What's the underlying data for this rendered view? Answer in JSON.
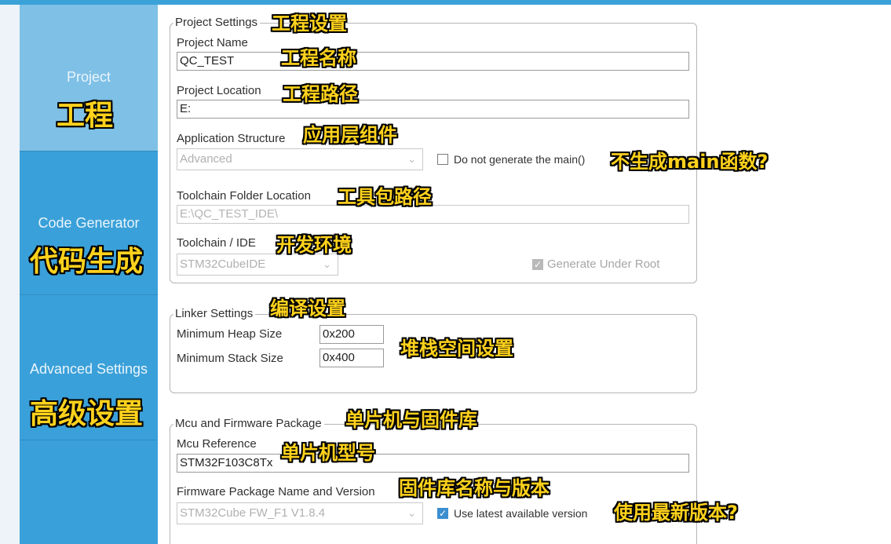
{
  "sidebar": {
    "items": [
      {
        "label": "Project",
        "note": "工程"
      },
      {
        "label": "Code Generator",
        "note": "代码生成"
      },
      {
        "label": "Advanced Settings",
        "note": "高级设置"
      }
    ]
  },
  "project_settings": {
    "legend": "Project Settings",
    "legend_note": "工程设置",
    "project_name": {
      "label": "Project Name",
      "value": "QC_TEST",
      "note": "工程名称"
    },
    "project_location": {
      "label": "Project Location",
      "value": "E:",
      "note": "工程路径"
    },
    "application_structure": {
      "label": "Application Structure",
      "value": "Advanced",
      "note": "应用层组件"
    },
    "no_main": {
      "label": "Do not generate the main()",
      "checked": false,
      "note": "不生成main函数?"
    },
    "toolchain_folder": {
      "label": "Toolchain Folder Location",
      "value": "E:\\QC_TEST_IDE\\",
      "note": "工具包路径"
    },
    "toolchain_ide": {
      "label": "Toolchain / IDE",
      "value": "STM32CubeIDE",
      "note": "开发环境"
    },
    "generate_under_root": {
      "label": "Generate Under Root",
      "checked": true
    }
  },
  "linker_settings": {
    "legend": "Linker Settings",
    "legend_note": "编译设置",
    "heap": {
      "label": "Minimum Heap Size",
      "value": "0x200"
    },
    "stack": {
      "label": "Minimum Stack Size",
      "value": "0x400"
    },
    "note": "堆栈空间设置"
  },
  "mcu_package": {
    "legend": "Mcu and Firmware Package",
    "legend_note": "单片机与固件库",
    "mcu_reference": {
      "label": "Mcu Reference",
      "value": "STM32F103C8Tx",
      "note": "单片机型号"
    },
    "firmware": {
      "label": "Firmware Package Name and Version",
      "value": "STM32Cube FW_F1 V1.8.4",
      "note": "固件库名称与版本"
    },
    "use_latest": {
      "label": "Use latest available version",
      "checked": true,
      "note": "使用最新版本?"
    }
  },
  "colors": {
    "sidebar": "#3aa0d9",
    "sidebar_active": "#7fc0e6",
    "annotation_fill": "#ffd21c",
    "annotation_outline": "#000000",
    "checkbox_checked": "#3b8ed0"
  }
}
